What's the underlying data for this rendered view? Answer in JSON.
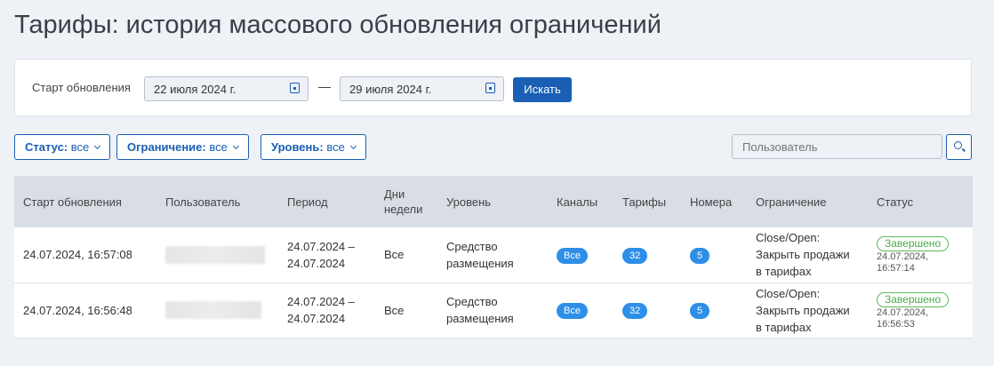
{
  "title": "Тарифы: история массового обновления ограничений",
  "search": {
    "label": "Старт обновления",
    "date_from": "22 июля 2024 г.",
    "date_to": "29 июля 2024 г.",
    "separator": "—",
    "button": "Искать"
  },
  "filters": [
    {
      "name": "Статус:",
      "value": "все"
    },
    {
      "name": "Ограничение:",
      "value": "все"
    },
    {
      "name": "Уровень:",
      "value": "все"
    }
  ],
  "user_placeholder": "Пользователь",
  "columns": [
    "Старт обновления",
    "Пользователь",
    "Период",
    "Дни недели",
    "Уровень",
    "Каналы",
    "Тарифы",
    "Номера",
    "Ограничение",
    "Статус"
  ],
  "rows": [
    {
      "start": "24.07.2024, 16:57:08",
      "period_from": "24.07.2024 –",
      "period_to": "24.07.2024",
      "days": "Все",
      "level": "Средство размещения",
      "channels": "Все",
      "tariffs": "32",
      "rooms": "5",
      "restriction": "Close/Open: Закрыть продажи в тарифах",
      "status": "Завершено",
      "status_date": "24.07.2024,",
      "status_time": "16:57:14"
    },
    {
      "start": "24.07.2024, 16:56:48",
      "period_from": "24.07.2024 –",
      "period_to": "24.07.2024",
      "days": "Все",
      "level": "Средство размещения",
      "channels": "Все",
      "tariffs": "32",
      "rooms": "5",
      "restriction": "Close/Open: Закрыть продажи в тарифах",
      "status": "Завершено",
      "status_date": "24.07.2024,",
      "status_time": "16:56:53"
    }
  ]
}
